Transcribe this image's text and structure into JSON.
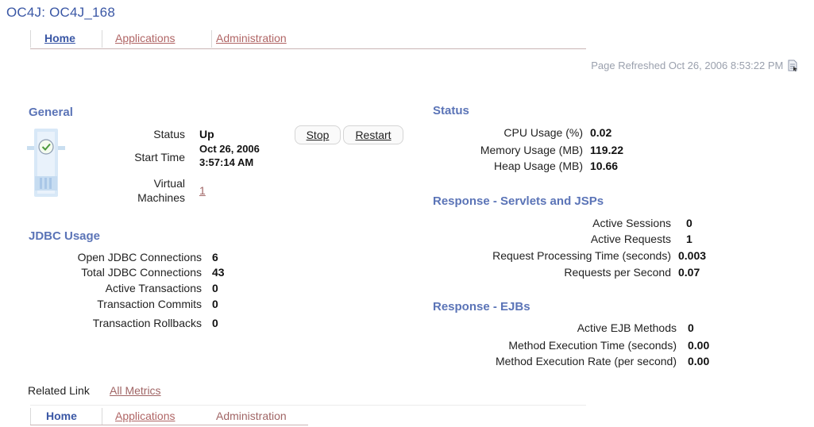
{
  "page": {
    "title": "OC4J: OC4J_168"
  },
  "tabs_top": [
    {
      "label": "Home",
      "active": true
    },
    {
      "label": "Applications",
      "active": false
    },
    {
      "label": "Administration",
      "active": false
    }
  ],
  "tabs_bottom": [
    {
      "label": "Home",
      "active": true
    },
    {
      "label": "Applications",
      "active": false
    },
    {
      "label": "Administration",
      "active": false
    }
  ],
  "refreshed": {
    "text": "Page Refreshed Oct 26, 2006 8:53:22 PM"
  },
  "general": {
    "heading": "General",
    "status_label": "Status",
    "status_value": "Up",
    "start_label": "Start Time",
    "start_value_line1": "Oct 26, 2006",
    "start_value_line2": "3:57:14 AM",
    "vm_label_line1": "Virtual",
    "vm_label_line2": "Machines",
    "vm_value": "1",
    "stop_label": "Stop",
    "restart_label": "Restart"
  },
  "jdbc": {
    "heading": "JDBC Usage",
    "rows": [
      {
        "label": "Open JDBC Connections",
        "value": "6"
      },
      {
        "label": "Total JDBC Connections",
        "value": "43"
      },
      {
        "label": "Active Transactions",
        "value": "0"
      },
      {
        "label": "Transaction Commits",
        "value": "0"
      },
      {
        "label": "Transaction Rollbacks",
        "value": "0"
      }
    ]
  },
  "status": {
    "heading": "Status",
    "rows": [
      {
        "label": "CPU Usage (%)",
        "value": "0.02"
      },
      {
        "label": "Memory Usage (MB)",
        "value": "119.22"
      },
      {
        "label": "Heap Usage (MB)",
        "value": "10.66"
      }
    ]
  },
  "servlets": {
    "heading": "Response - Servlets and JSPs",
    "rows": [
      {
        "label": "Active Sessions",
        "value": "0"
      },
      {
        "label": "Active Requests",
        "value": "1"
      },
      {
        "label": "Request Processing Time (seconds)",
        "value": "0.003"
      },
      {
        "label": "Requests per Second",
        "value": "0.07"
      }
    ]
  },
  "ejbs": {
    "heading": "Response - EJBs",
    "rows": [
      {
        "label": "Active EJB Methods",
        "value": "0"
      },
      {
        "label": "Method Execution Time (seconds)",
        "value": "0.00"
      },
      {
        "label": "Method Execution Rate (per second)",
        "value": "0.00"
      }
    ]
  },
  "related": {
    "label": "Related Link",
    "link": "All Metrics"
  }
}
